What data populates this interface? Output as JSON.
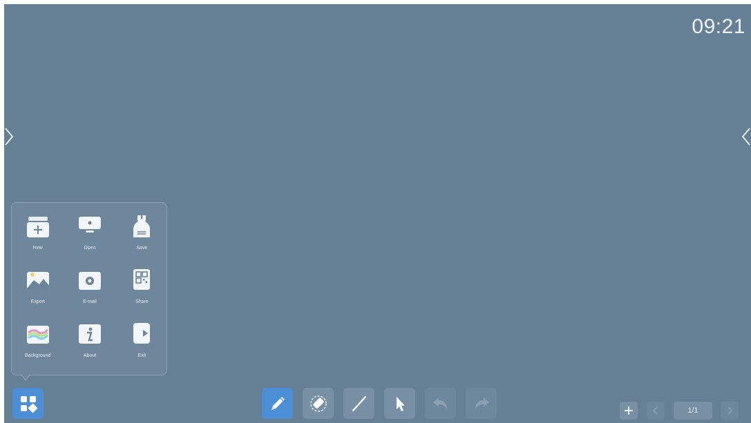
{
  "status": {
    "clock": "09:21"
  },
  "menu": {
    "items": [
      {
        "label": "New",
        "icon": "new-board-icon"
      },
      {
        "label": "Open",
        "icon": "open-folder-icon"
      },
      {
        "label": "Save",
        "icon": "save-icon"
      },
      {
        "label": "Export",
        "icon": "export-image-icon"
      },
      {
        "label": "E-mail",
        "icon": "email-icon"
      },
      {
        "label": "Share",
        "icon": "share-qr-icon"
      },
      {
        "label": "Background",
        "icon": "background-icon"
      },
      {
        "label": "About",
        "icon": "about-info-icon"
      },
      {
        "label": "Exit",
        "icon": "exit-icon"
      }
    ]
  },
  "toolbar": {
    "tools": [
      "pen-icon",
      "eraser-icon",
      "line-icon",
      "select-icon",
      "undo-icon",
      "redo-icon"
    ],
    "active_tool": "pen",
    "accent": "#4d8fd6"
  },
  "pager": {
    "indicator": "1/1"
  }
}
